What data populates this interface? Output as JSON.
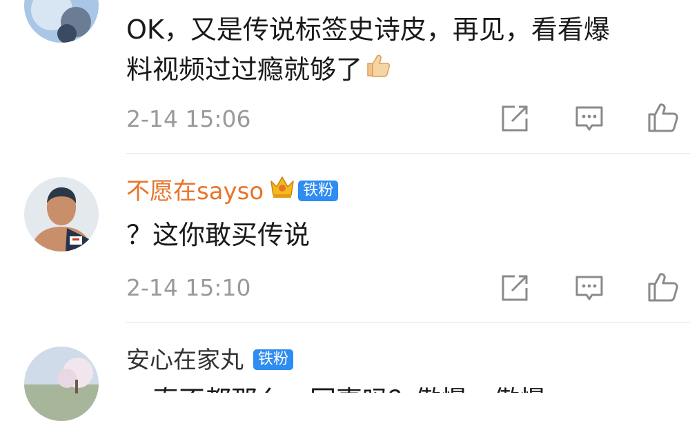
{
  "comments": [
    {
      "text_line1": "OK，又是传说标签史诗皮，再见，看看爆",
      "text_line2": "料视频过过瘾就够了",
      "emoji": "thumbs-up-emoji",
      "timestamp": "2-14 15:06"
    },
    {
      "username": "不愿在sayso",
      "badge": "铁粉",
      "text": "？这你敢买传说",
      "timestamp": "2-14 15:10"
    },
    {
      "username": "安心在家丸",
      "badge": "铁粉",
      "text": "一直不都那么一回事吗？傲慢、傲慢，很难"
    }
  ],
  "colors": {
    "username": "#e8742b",
    "username_plain": "#333333",
    "badge": "#2f8cf0",
    "timestamp": "#9a9a9a",
    "icon": "#8a8a8a"
  }
}
